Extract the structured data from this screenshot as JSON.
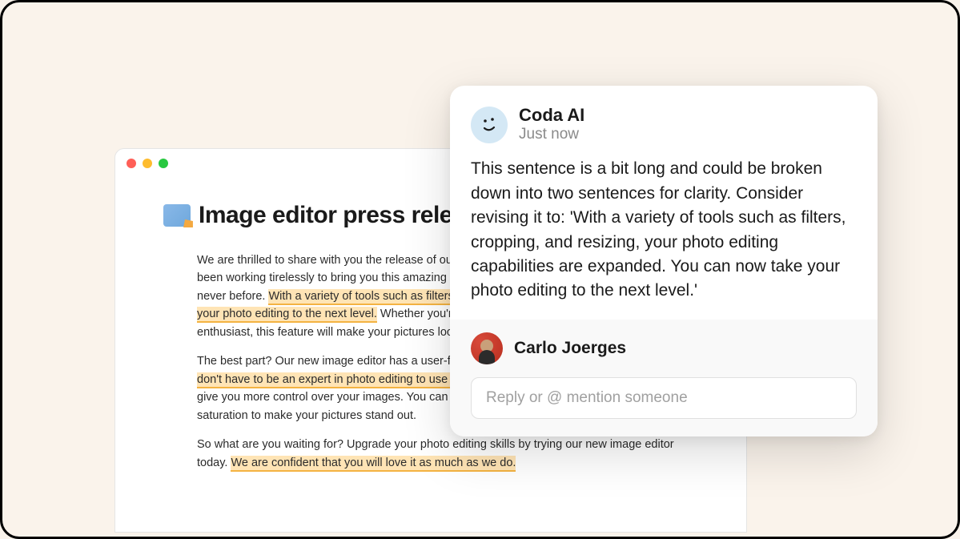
{
  "document": {
    "title": "Image editor press release",
    "para1_pre": "We are thrilled to share with you the release of our latest image editor feature. Our team has been working tirelessly to bring you this amazing tool that allows you to enhance your images like never before. ",
    "para1_hl": "With a variety of tools such as filters, cropping, resizing, and more, you can take your photo editing to the next level.",
    "para1_post": " Whether you're a professional photographer or just an enthusiast, this feature will make your pictures look stunning.",
    "para2_pre": "The best part? Our new image editor has a user-friendly interface that is easy to navigate, so ",
    "para2_hl": "you don't have to be an expert in photo editing to use it.",
    "para2_post": " Plus, we've added some new features that give you more control over your images. You can now adjust the brightness, contrast, and saturation to make your pictures stand out.",
    "para3_pre": "So what are you waiting for? Upgrade your photo editing skills by trying our new image editor today. ",
    "para3_hl": "We are confident that you will love it as much as we do.",
    "para3_post": ""
  },
  "comment": {
    "author": "Coda AI",
    "timestamp": "Just now",
    "body": "This sentence is a bit long and could be broken down into two sentences for clarity. Consider revising it to: 'With a variety of tools such as filters, cropping, and resizing, your photo editing capabilities are expanded. You can now take your photo editing to the next level.'"
  },
  "reply": {
    "user": "Carlo Joerges",
    "placeholder": "Reply or @ mention someone"
  }
}
